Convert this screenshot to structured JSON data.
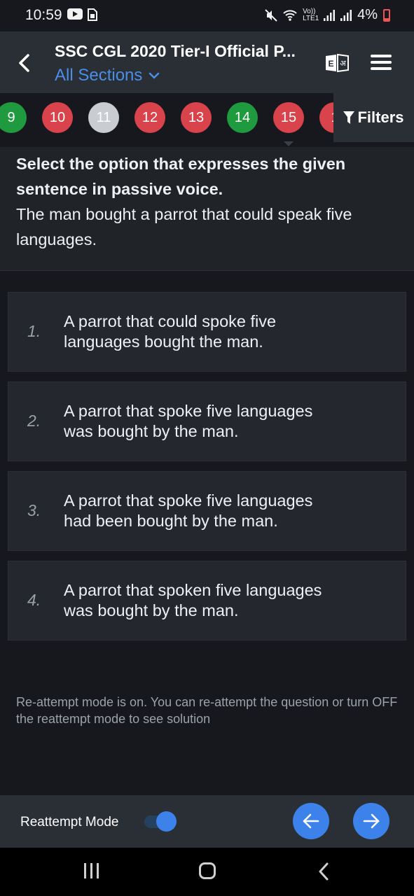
{
  "status_bar": {
    "time": "10:59",
    "battery": "4%",
    "network": "Vo)) LTE1",
    "icons": [
      "youtube-icon",
      "sim-icon",
      "mute-icon",
      "wifi-icon",
      "signal-icon",
      "signal-icon-2",
      "battery-icon"
    ]
  },
  "header": {
    "title": "SSC CGL 2020 Tier-I Official P...",
    "sections_label": "All Sections"
  },
  "question_nav": {
    "items": [
      {
        "label": "9",
        "status": "green"
      },
      {
        "label": "10",
        "status": "red"
      },
      {
        "label": "11",
        "status": "grey"
      },
      {
        "label": "12",
        "status": "red"
      },
      {
        "label": "13",
        "status": "red"
      },
      {
        "label": "14",
        "status": "green"
      },
      {
        "label": "15",
        "status": "red"
      },
      {
        "label": "1",
        "status": "red"
      }
    ],
    "filters_label": "Filters"
  },
  "question": {
    "instruction": "Select the option that expresses the given sentence in passive voice.",
    "sentence": "The man bought a parrot that could speak five languages."
  },
  "options": [
    {
      "num": "1.",
      "line1": "A parrot that could spoke five",
      "line2": "languages bought the man."
    },
    {
      "num": "2.",
      "line1": "A parrot that spoke five languages",
      "line2": "was bought by the man."
    },
    {
      "num": "3.",
      "line1": "A parrot that spoke five languages",
      "line2": "had been bought by the man."
    },
    {
      "num": "4.",
      "line1": "A parrot that spoken five languages",
      "line2": "was bought by the man."
    }
  ],
  "notice": "Re-attempt mode is on. You can re-attempt the question or turn OFF the reattempt mode to see solution",
  "bottom_bar": {
    "reattempt_label": "Reattempt Mode",
    "reattempt_on": true
  },
  "colors": {
    "accent": "#3d82ea",
    "red": "#d9434b",
    "green": "#1f9a3e",
    "header_bg": "#2a2e35"
  }
}
